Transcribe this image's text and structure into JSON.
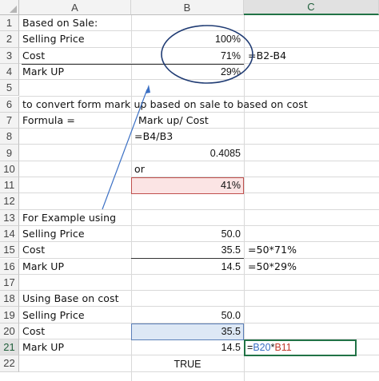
{
  "columns": [
    "A",
    "B",
    "C"
  ],
  "rows": [
    "1",
    "2",
    "3",
    "4",
    "5",
    "6",
    "7",
    "8",
    "9",
    "10",
    "11",
    "12",
    "13",
    "14",
    "15",
    "16",
    "17",
    "18",
    "19",
    "20",
    "21",
    "22"
  ],
  "cells": {
    "a1": "Based on Sale:",
    "a2": "Selling Price",
    "b2": "100%",
    "a3": "Cost",
    "b3": "71%",
    "c3": "=B2-B4",
    "a4": "Mark UP",
    "b4": "29%",
    "a6": "to convert form mark up based on sale to based on cost",
    "a7": "Formula =",
    "b7": "Mark up/ Cost",
    "b8": "=B4/B3",
    "b9": "0.4085",
    "b10": "or",
    "b11": "41%",
    "a13": "For Example using",
    "a14": "Selling Price",
    "b14": "50.0",
    "a15": "Cost",
    "b15": "35.5",
    "c15": "=50*71%",
    "a16": "Mark UP",
    "b16": "14.5",
    "c16": "=50*29%",
    "a18": "Using Base on cost",
    "a19": "Selling Price",
    "b19": "50.0",
    "a20": "Cost",
    "b20": "35.5",
    "a21": "Mark UP",
    "b21": "14.5",
    "c21_eq": "=",
    "c21_ref1": "B20",
    "c21_op": "*",
    "c21_ref2": "B11",
    "b22": "TRUE"
  },
  "colors": {
    "excel_green": "#217346",
    "ref_blue": "#3a6fc4",
    "ref_red": "#c0392b",
    "annotation": "#1f3b73"
  }
}
